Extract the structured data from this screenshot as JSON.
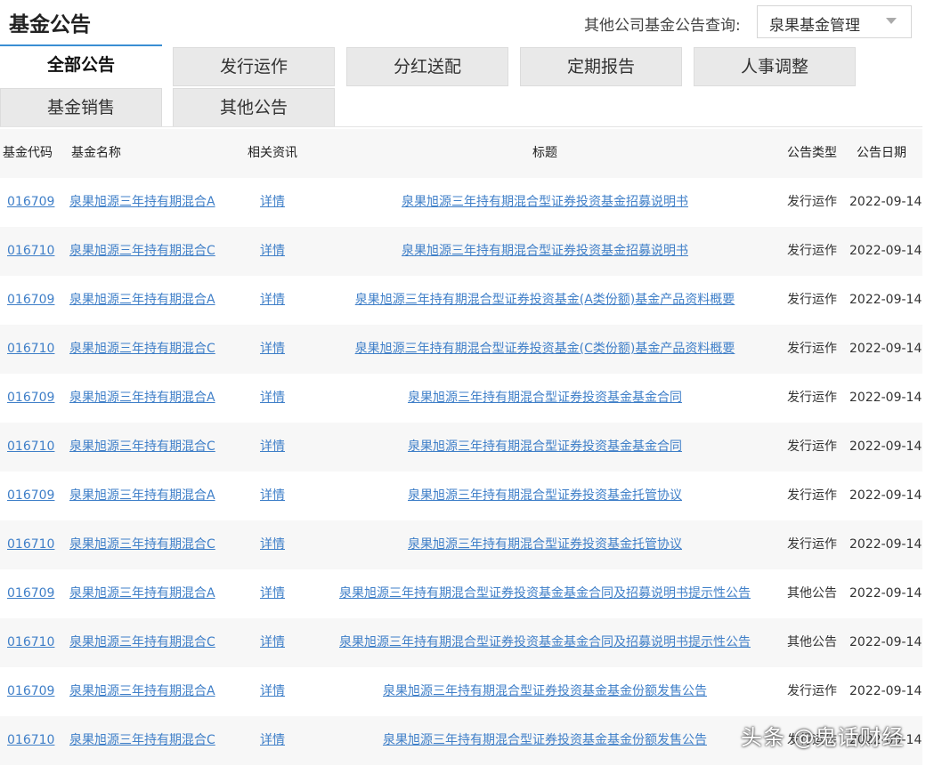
{
  "header": {
    "title": "基金公告",
    "query_label": "其他公司基金公告查询:",
    "company_select_value": "泉果基金管理"
  },
  "tabs": [
    {
      "label": "全部公告",
      "active": true
    },
    {
      "label": "发行运作",
      "active": false
    },
    {
      "label": "分红送配",
      "active": false
    },
    {
      "label": "定期报告",
      "active": false
    },
    {
      "label": "人事调整",
      "active": false
    },
    {
      "label": "基金销售",
      "active": false
    },
    {
      "label": "其他公告",
      "active": false
    }
  ],
  "table": {
    "headers": {
      "code": "基金代码",
      "name": "基金名称",
      "info": "相关资讯",
      "title": "标题",
      "type": "公告类型",
      "date": "公告日期"
    },
    "rows": [
      {
        "code": "016709",
        "name": "泉果旭源三年持有期混合A",
        "info": "详情",
        "title": "泉果旭源三年持有期混合型证券投资基金招募说明书",
        "type": "发行运作",
        "date": "2022-09-14"
      },
      {
        "code": "016710",
        "name": "泉果旭源三年持有期混合C",
        "info": "详情",
        "title": "泉果旭源三年持有期混合型证券投资基金招募说明书",
        "type": "发行运作",
        "date": "2022-09-14"
      },
      {
        "code": "016709",
        "name": "泉果旭源三年持有期混合A",
        "info": "详情",
        "title": "泉果旭源三年持有期混合型证券投资基金(A类份额)基金产品资料概要",
        "type": "发行运作",
        "date": "2022-09-14"
      },
      {
        "code": "016710",
        "name": "泉果旭源三年持有期混合C",
        "info": "详情",
        "title": "泉果旭源三年持有期混合型证券投资基金(C类份额)基金产品资料概要",
        "type": "发行运作",
        "date": "2022-09-14"
      },
      {
        "code": "016709",
        "name": "泉果旭源三年持有期混合A",
        "info": "详情",
        "title": "泉果旭源三年持有期混合型证券投资基金基金合同",
        "type": "发行运作",
        "date": "2022-09-14"
      },
      {
        "code": "016710",
        "name": "泉果旭源三年持有期混合C",
        "info": "详情",
        "title": "泉果旭源三年持有期混合型证券投资基金基金合同",
        "type": "发行运作",
        "date": "2022-09-14"
      },
      {
        "code": "016709",
        "name": "泉果旭源三年持有期混合A",
        "info": "详情",
        "title": "泉果旭源三年持有期混合型证券投资基金托管协议",
        "type": "发行运作",
        "date": "2022-09-14"
      },
      {
        "code": "016710",
        "name": "泉果旭源三年持有期混合C",
        "info": "详情",
        "title": "泉果旭源三年持有期混合型证券投资基金托管协议",
        "type": "发行运作",
        "date": "2022-09-14"
      },
      {
        "code": "016709",
        "name": "泉果旭源三年持有期混合A",
        "info": "详情",
        "title": "泉果旭源三年持有期混合型证券投资基金基金合同及招募说明书提示性公告",
        "type": "其他公告",
        "date": "2022-09-14"
      },
      {
        "code": "016710",
        "name": "泉果旭源三年持有期混合C",
        "info": "详情",
        "title": "泉果旭源三年持有期混合型证券投资基金基金合同及招募说明书提示性公告",
        "type": "其他公告",
        "date": "2022-09-14"
      },
      {
        "code": "016709",
        "name": "泉果旭源三年持有期混合A",
        "info": "详情",
        "title": "泉果旭源三年持有期混合型证券投资基金基金份额发售公告",
        "type": "发行运作",
        "date": "2022-09-14"
      },
      {
        "code": "016710",
        "name": "泉果旭源三年持有期混合C",
        "info": "详情",
        "title": "泉果旭源三年持有期混合型证券投资基金基金份额发售公告",
        "type": "发行运作",
        "date": "2022-09-14"
      }
    ]
  },
  "watermark": "头条 @鬼话财经",
  "colors": {
    "link": "#3f7fc8",
    "active_tab_border": "#3a8ed3",
    "tab_bg": "#e9e9e9",
    "row_alt_bg": "#f7f7f7"
  }
}
